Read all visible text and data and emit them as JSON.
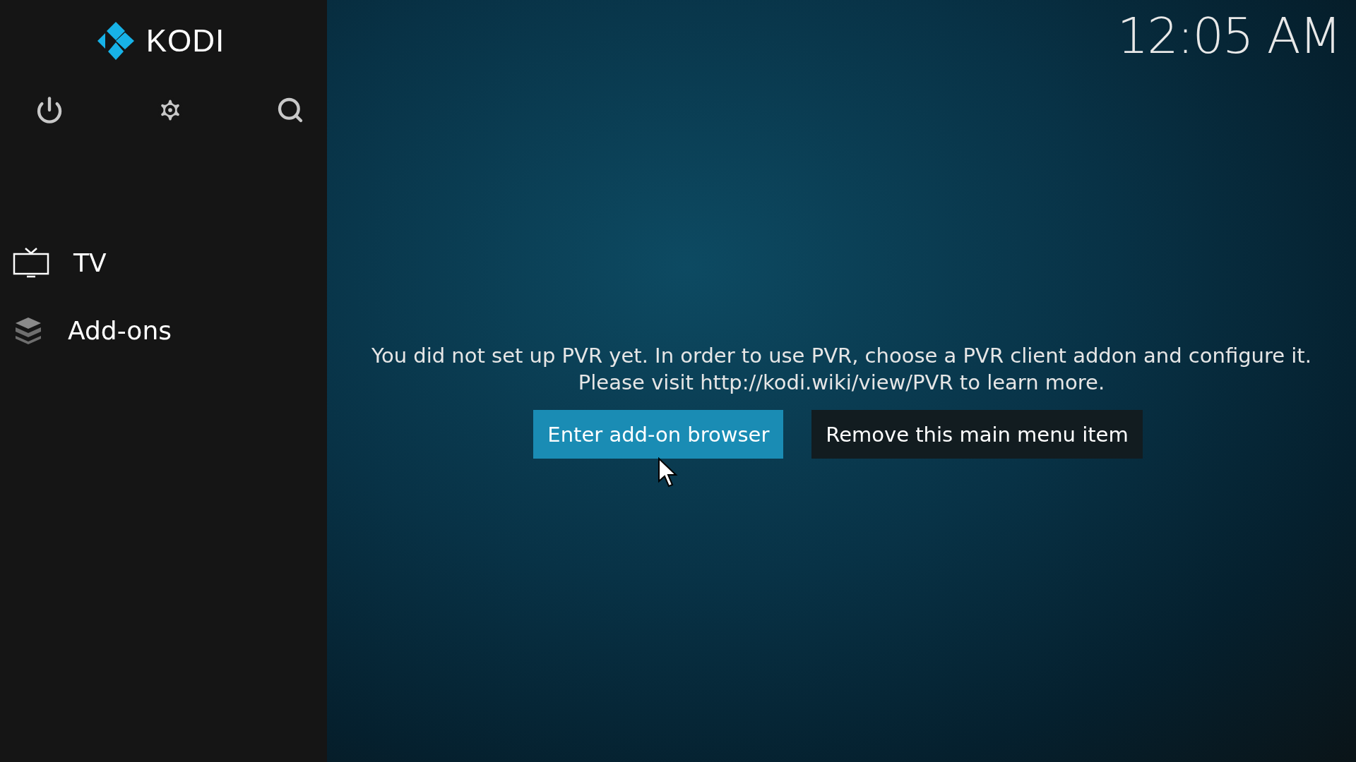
{
  "logo": {
    "text": "KODI"
  },
  "clock": "12:05 AM",
  "toolbar": [
    {
      "kind": "power"
    },
    {
      "kind": "settings"
    },
    {
      "kind": "search"
    }
  ],
  "menu": [
    {
      "kind": "tv",
      "label": "TV"
    },
    {
      "kind": "addons",
      "label": "Add-ons"
    }
  ],
  "message": [
    "You did not set up PVR yet. In order to use PVR, choose a PVR client addon and configure it.",
    "Please visit http://kodi.wiki/view/PVR to learn more."
  ],
  "buttons": [
    {
      "label": "Enter add-on browser",
      "focused": true
    },
    {
      "label": "Remove this main menu item",
      "focused": false
    }
  ]
}
